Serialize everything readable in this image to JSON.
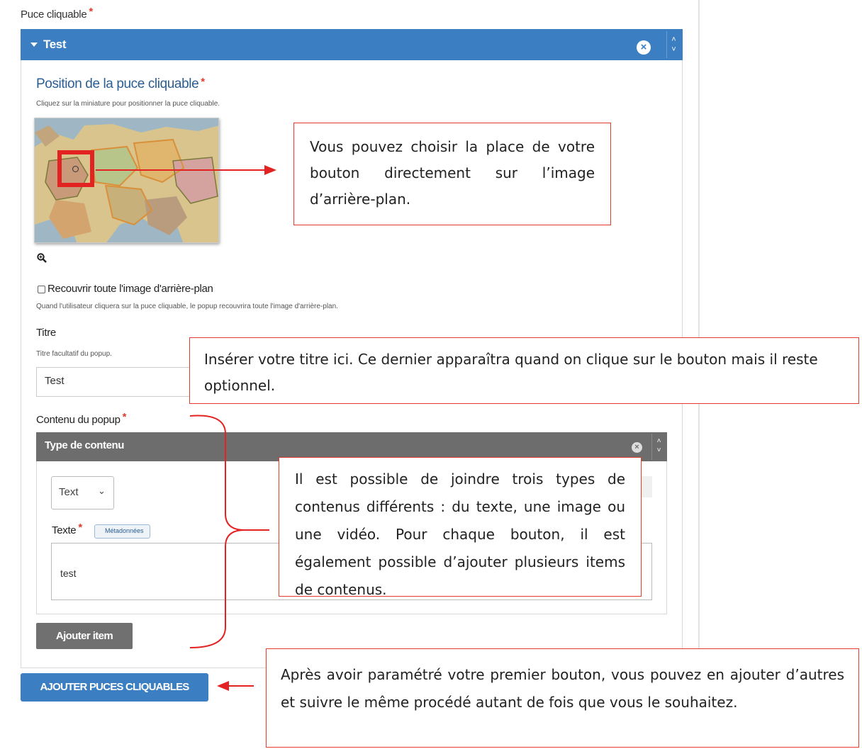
{
  "top_label": "Puce cliquable",
  "header": {
    "title": "Test"
  },
  "position": {
    "title": "Position de la puce cliquable",
    "description": "Cliquez sur la miniature pour positionner la puce cliquable."
  },
  "cover": {
    "label": "Recouvrir toute l'image d'arrière-plan",
    "description": "Quand l'utilisateur cliquera sur la puce cliquable, le popup recouvrira toute l'image d'arrière-plan.",
    "checked": false
  },
  "titre": {
    "label": "Titre",
    "description": "Titre facultatif du popup.",
    "value": "Test"
  },
  "popup": {
    "label": "Contenu du popup",
    "type_title": "Type de contenu",
    "select_value": "Text",
    "texte_label": "Texte",
    "meta_badge": "Métadonnées",
    "texte_value": "test",
    "add_item_label": "Ajouter item"
  },
  "add_hotspots_label": "AJOUTER PUCES CLIQUABLES",
  "callouts": {
    "c1": "Vous pouvez choisir la place de votre bouton directement sur l’image d’arrière-plan.",
    "c2": "Insérer votre titre ici. Ce dernier apparaîtra quand on clique sur le bouton mais il reste optionnel.",
    "c3": "Il est possible de joindre trois types de contenus différents : du texte, une image ou une vidéo. Pour chaque bouton, il est également possible d’ajouter plusieurs items de contenus.",
    "c4": "Après avoir paramétré votre premier bouton, vous pouvez en ajouter d’autres et suivre le même procédé autant de fois que vous le souhaitez."
  },
  "colors": {
    "accent_blue": "#3b7ec1",
    "required_red": "#e53b2c",
    "callout_red": "#e53b2c",
    "grey_bar": "#6d6d6d"
  }
}
